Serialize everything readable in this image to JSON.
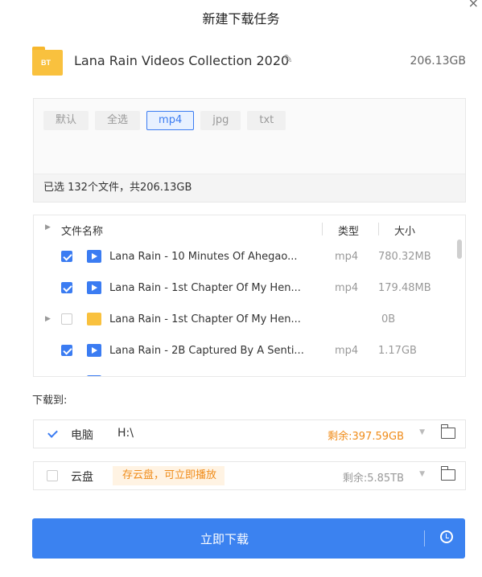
{
  "dialog": {
    "title": "新建下载任务",
    "close": "×"
  },
  "task": {
    "icon_label": "BT",
    "name": "Lana Rain Videos Collection 2020",
    "edit_icon": "pencil-icon",
    "total_size": "206.13GB"
  },
  "filters": {
    "chips": [
      {
        "label": "默认",
        "active": false
      },
      {
        "label": "全选",
        "active": false
      },
      {
        "label": "mp4",
        "active": true
      },
      {
        "label": "jpg",
        "active": false
      },
      {
        "label": "txt",
        "active": false
      }
    ],
    "selection_info": "已选 132个文件，共206.13GB"
  },
  "file_list": {
    "headers": {
      "name": "文件名称",
      "type": "类型",
      "size": "大小"
    },
    "rows": [
      {
        "name": "Lana Rain - 10 Minutes Of Ahegao...",
        "type": "mp4",
        "size": "780.32MB",
        "checked": true,
        "icon": "video",
        "expander": ""
      },
      {
        "name": "Lana Rain - 1st Chapter Of My Hen...",
        "type": "mp4",
        "size": "179.48MB",
        "checked": true,
        "icon": "video",
        "expander": ""
      },
      {
        "name": "Lana Rain - 1st Chapter Of My Hen...",
        "type": "",
        "size": "0B",
        "checked": false,
        "icon": "folder",
        "expander": "▶"
      },
      {
        "name": "Lana Rain - 2B Captured By A Senti...",
        "type": "mp4",
        "size": "1.17GB",
        "checked": true,
        "icon": "video",
        "expander": ""
      }
    ]
  },
  "download_to": {
    "label": "下载到:",
    "local": {
      "name": "电脑",
      "path": "H:\\",
      "free": "剩余:397.59GB",
      "checked": true,
      "free_color": "#f08c1a"
    },
    "cloud": {
      "name": "云盘",
      "promo": "存云盘，可立即播放",
      "free": "剩余:5.85TB",
      "checked": false,
      "free_color": "#999999"
    }
  },
  "primary_button": {
    "label": "立即下载"
  },
  "colors": {
    "accent": "#3b82f0",
    "folder": "#f9c13e",
    "warning": "#f08c1a"
  }
}
